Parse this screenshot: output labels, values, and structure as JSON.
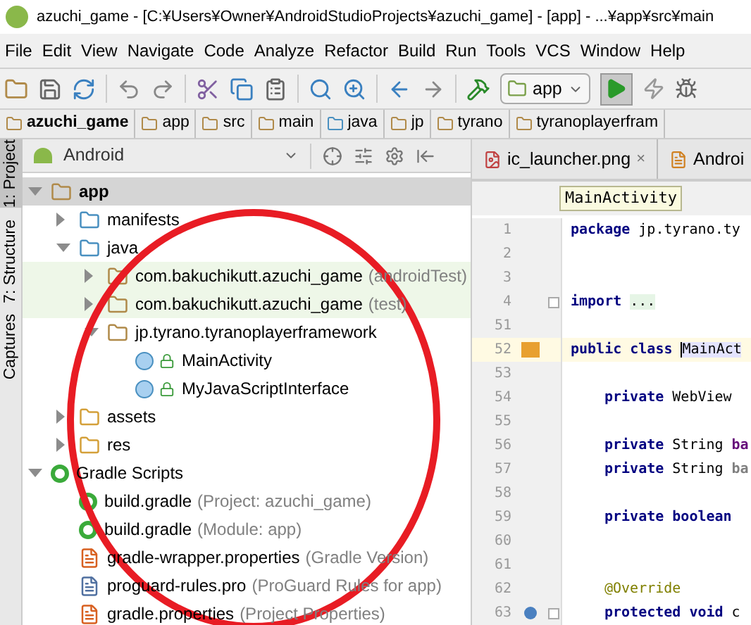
{
  "window": {
    "title": "azuchi_game - [C:¥Users¥Owner¥AndroidStudioProjects¥azuchi_game] - [app] - ...¥app¥src¥main"
  },
  "menu": [
    "File",
    "Edit",
    "View",
    "Navigate",
    "Code",
    "Analyze",
    "Refactor",
    "Build",
    "Run",
    "Tools",
    "VCS",
    "Window",
    "Help"
  ],
  "toolbar": {
    "run_config": "app"
  },
  "breadcrumbs": [
    "azuchi_game",
    "app",
    "src",
    "main",
    "java",
    "jp",
    "tyrano",
    "tyranoplayerfram"
  ],
  "side_tabs": [
    {
      "label": "1: Project",
      "selected": true
    },
    {
      "label": "7: Structure",
      "selected": false
    },
    {
      "label": "Captures",
      "selected": false
    }
  ],
  "project": {
    "view": "Android",
    "tree": [
      {
        "label": "app",
        "kind": "module",
        "expanded": true,
        "selected": true,
        "children": [
          {
            "label": "manifests",
            "kind": "folder",
            "expanded": false,
            "selected": false
          },
          {
            "label": "java",
            "kind": "folder",
            "expanded": true,
            "selected": false,
            "children": [
              {
                "label": "com.bakuchikutt.azuchi_game",
                "suffix": "(androidTest)",
                "kind": "test-package",
                "expanded": false,
                "selected": false
              },
              {
                "label": "com.bakuchikutt.azuchi_game",
                "suffix": "(test)",
                "kind": "test-package",
                "expanded": false,
                "selected": false
              },
              {
                "label": "jp.tyrano.tyranoplayerframework",
                "kind": "package",
                "expanded": true,
                "selected": false,
                "children": [
                  {
                    "label": "MainActivity",
                    "kind": "class",
                    "selected": false
                  },
                  {
                    "label": "MyJavaScriptInterface",
                    "kind": "class",
                    "selected": false
                  }
                ]
              }
            ]
          },
          {
            "label": "assets",
            "kind": "res-folder",
            "expanded": false,
            "selected": false
          },
          {
            "label": "res",
            "kind": "res-folder",
            "expanded": false,
            "selected": false
          }
        ]
      },
      {
        "label": "Gradle Scripts",
        "kind": "gradle-root",
        "expanded": true,
        "selected": false,
        "children": [
          {
            "label": "build.gradle",
            "suffix": "(Project: azuchi_game)",
            "kind": "gradle",
            "selected": false
          },
          {
            "label": "build.gradle",
            "suffix": "(Module: app)",
            "kind": "gradle",
            "selected": false
          },
          {
            "label": "gradle-wrapper.properties",
            "suffix": "(Gradle Version)",
            "kind": "properties",
            "selected": false
          },
          {
            "label": "proguard-rules.pro",
            "suffix": "(ProGuard Rules for app)",
            "kind": "text",
            "selected": false
          },
          {
            "label": "gradle.properties",
            "suffix": "(Project Properties)",
            "kind": "properties",
            "selected": false
          }
        ]
      }
    ]
  },
  "editor": {
    "tabs": [
      {
        "label": "ic_launcher.png",
        "close": "×",
        "selected": false
      },
      {
        "label": "Androi",
        "selected": false
      }
    ],
    "tooltip": "MainActivity",
    "lines": [
      {
        "number": "1",
        "kind": "top",
        "tokens": [
          {
            "kind": "keyword",
            "text": "package"
          },
          {
            "kind": "plain",
            "text": "jp.tyrano.ty"
          }
        ]
      },
      {
        "number": "2"
      },
      {
        "number": "3"
      },
      {
        "number": "4",
        "kind": "top",
        "fold": true,
        "tokens": [
          {
            "kind": "keyword",
            "text": "import"
          },
          {
            "kind": "folded",
            "text": "..."
          }
        ]
      },
      {
        "number": "51"
      },
      {
        "number": "52",
        "kind": "top",
        "current": true,
        "class_marker": true,
        "tokens": [
          {
            "kind": "keyword",
            "text": "public class"
          },
          {
            "kind": "selected",
            "text": "MainAct"
          }
        ]
      },
      {
        "number": "53"
      },
      {
        "number": "54",
        "kind": "member",
        "tokens": [
          {
            "kind": "keyword",
            "text": "private"
          },
          {
            "kind": "plain",
            "text": "WebView"
          }
        ]
      },
      {
        "number": "55"
      },
      {
        "number": "56",
        "kind": "member",
        "tokens": [
          {
            "kind": "keyword",
            "text": "private"
          },
          {
            "kind": "plain",
            "text": "String"
          },
          {
            "kind": "field",
            "text": "ba"
          }
        ]
      },
      {
        "number": "57",
        "kind": "member",
        "tokens": [
          {
            "kind": "keyword",
            "text": "private"
          },
          {
            "kind": "plain",
            "text": "String"
          },
          {
            "kind": "unused",
            "text": "ba"
          }
        ]
      },
      {
        "number": "58"
      },
      {
        "number": "59",
        "kind": "member",
        "tokens": [
          {
            "kind": "keyword",
            "text": "private boolean"
          }
        ]
      },
      {
        "number": "60"
      },
      {
        "number": "61"
      },
      {
        "number": "62",
        "kind": "member",
        "tokens": [
          {
            "kind": "annotation",
            "text": "@Override"
          }
        ]
      },
      {
        "number": "63",
        "kind": "member",
        "override_marker": true,
        "fold": true,
        "tokens": [
          {
            "kind": "keyword",
            "text": "protected void"
          },
          {
            "kind": "plain",
            "text": "c"
          }
        ]
      }
    ]
  }
}
